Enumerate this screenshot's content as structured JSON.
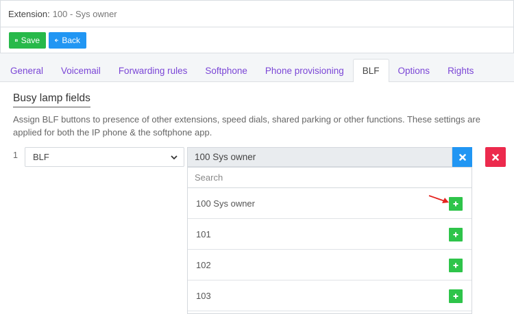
{
  "header": {
    "label": "Extension:",
    "value": "100 - Sys owner"
  },
  "toolbar": {
    "save_label": "Save",
    "back_label": "Back"
  },
  "tabs": [
    {
      "label": "General"
    },
    {
      "label": "Voicemail"
    },
    {
      "label": "Forwarding rules"
    },
    {
      "label": "Softphone"
    },
    {
      "label": "Phone provisioning"
    },
    {
      "label": "BLF",
      "active": true
    },
    {
      "label": "Options"
    },
    {
      "label": "Rights"
    }
  ],
  "blf": {
    "title": "Busy lamp fields",
    "description": "Assign BLF buttons to presence of other extensions, speed dials, shared parking or other functions. These settings are applied for both the IP phone & the softphone app.",
    "row": {
      "number": "1",
      "type_value": "BLF",
      "selected_value": "100 Sys owner"
    },
    "dropdown": {
      "search_placeholder": "Search",
      "options": [
        {
          "label": "100 Sys owner"
        },
        {
          "label": "101"
        },
        {
          "label": "102"
        },
        {
          "label": "103"
        }
      ]
    }
  },
  "colors": {
    "accent": "#7a45d6",
    "save": "#27b94a",
    "back": "#2196f3",
    "remove": "#ec2a4d",
    "add": "#2ec44a",
    "arrow": "#e5231f"
  },
  "icons": {
    "save": "floppy-disk-icon",
    "back": "arrow-left-icon",
    "clear": "x-icon",
    "remove": "x-icon",
    "add": "plus-icon",
    "select": "chevron-down-icon",
    "annotation": "red-arrow"
  }
}
